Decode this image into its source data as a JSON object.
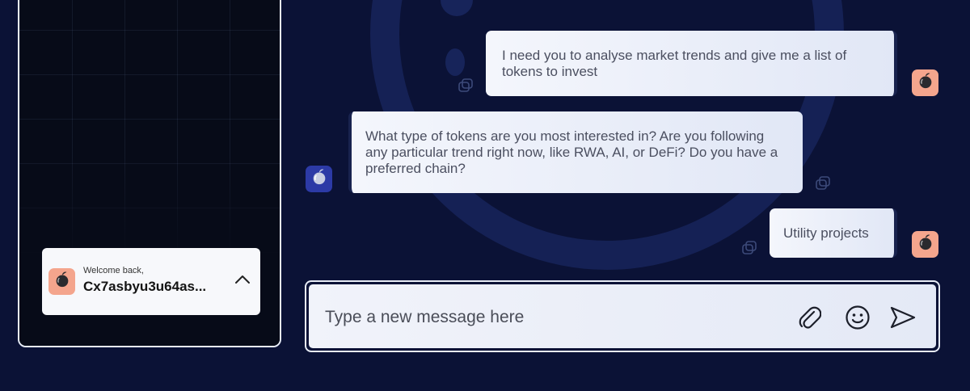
{
  "sidebar": {
    "welcome_label": "Welcome back,",
    "wallet_address": "Cx7asbyu3u64as...",
    "avatar_icon": "apple-logo-icon",
    "toggle_icon": "chevron-up-icon"
  },
  "chat": {
    "messages": [
      {
        "role": "user",
        "text": "I need you to analyse market trends and give me a list of tokens to invest"
      },
      {
        "role": "assistant",
        "text": "What type of tokens are you most interested in? Are you following any particular trend right now, like RWA, AI, or DeFi? Do you have a preferred chain?"
      },
      {
        "role": "user",
        "text": "Utility projects"
      }
    ],
    "message_action_icon": "copy-icon"
  },
  "composer": {
    "placeholder": "Type a new message here",
    "value": "",
    "attach_icon": "paperclip-icon",
    "emoji_icon": "smiley-icon",
    "send_icon": "send-icon"
  },
  "colors": {
    "background": "#0b1236",
    "user_avatar": "#f4a58d",
    "bot_avatar": "#2c3aa6",
    "bubble_accent": "#18224e"
  }
}
